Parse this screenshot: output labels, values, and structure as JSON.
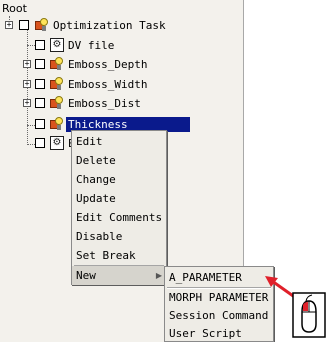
{
  "tree": {
    "root_label": "Root",
    "nodes": [
      {
        "label": "Optimization Task",
        "icon": "task-icon",
        "expander": "+"
      },
      {
        "label": "DV file",
        "icon": "gear-icon",
        "expander": ""
      },
      {
        "label": "Emboss_Depth",
        "icon": "task-icon",
        "expander": "+"
      },
      {
        "label": "Emboss_Width",
        "icon": "task-icon",
        "expander": "+"
      },
      {
        "label": "Emboss_Dist",
        "icon": "task-icon",
        "expander": "+"
      },
      {
        "label": "Thickness",
        "icon": "task-icon",
        "expander": "",
        "selected": true
      },
      {
        "label": "E",
        "icon": "gear-icon",
        "expander": ""
      }
    ]
  },
  "context_menu": {
    "items": [
      "Edit",
      "Delete",
      "Change",
      "Update",
      "Edit Comments",
      "Disable",
      "Set Break"
    ],
    "new_label": "New",
    "submenu_arrow": "▶"
  },
  "submenu": {
    "items": [
      "A_PARAMETER",
      "MORPH PARAMETER",
      "Session Command",
      "User Script"
    ]
  },
  "colors": {
    "selection": "#0a1a8c",
    "arrow": "#e0202a",
    "task_icon": "#d9541e"
  },
  "annotation": {
    "icon": "mouse-icon"
  }
}
